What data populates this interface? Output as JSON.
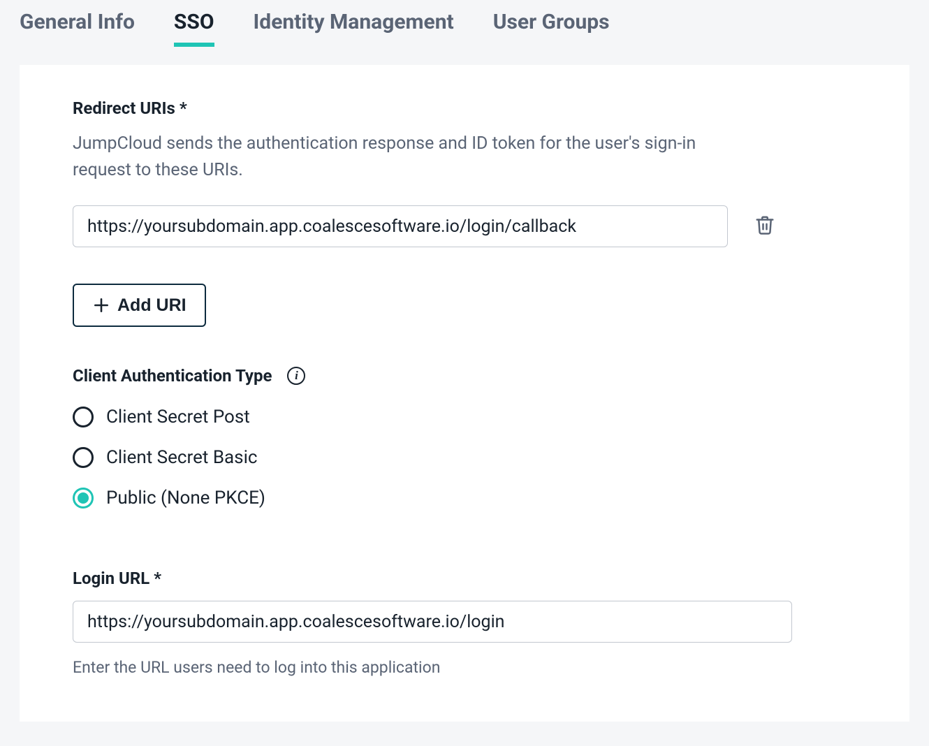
{
  "tabs": [
    {
      "label": "General Info",
      "active": false
    },
    {
      "label": "SSO",
      "active": true
    },
    {
      "label": "Identity Management",
      "active": false
    },
    {
      "label": "User Groups",
      "active": false
    }
  ],
  "redirect": {
    "label": "Redirect URIs *",
    "help": "JumpCloud sends the authentication response and ID token for the user's sign-in request to these URIs.",
    "value": "https://yoursubdomain.app.coalescesoftware.io/login/callback",
    "add_button": "Add URI"
  },
  "auth_type": {
    "label": "Client Authentication Type",
    "options": [
      {
        "label": "Client Secret Post",
        "selected": false
      },
      {
        "label": "Client Secret Basic",
        "selected": false
      },
      {
        "label": "Public (None PKCE)",
        "selected": true
      }
    ]
  },
  "login_url": {
    "label": "Login URL *",
    "value": "https://yoursubdomain.app.coalescesoftware.io/login",
    "hint": "Enter the URL users need to log into this application"
  }
}
